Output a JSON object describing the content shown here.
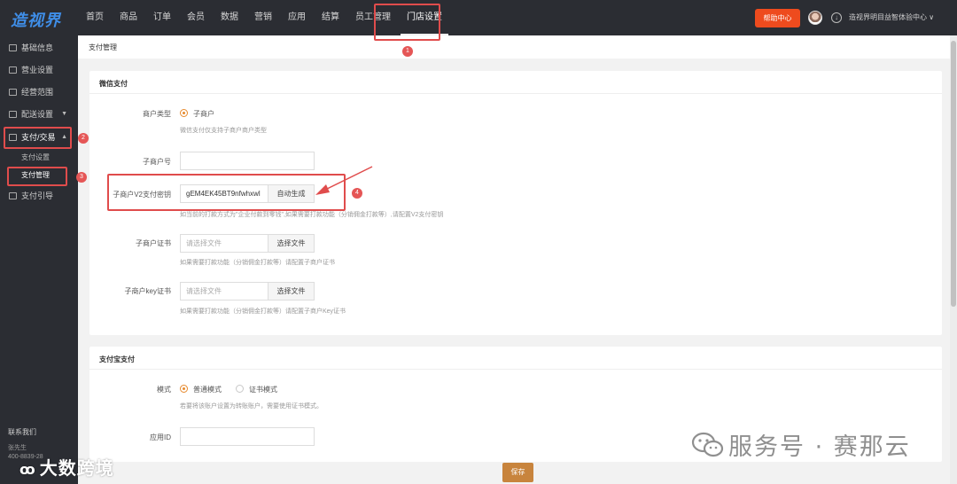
{
  "app": {
    "logo_text": "造视界"
  },
  "topnav": {
    "items": [
      "首页",
      "商品",
      "订单",
      "会员",
      "数据",
      "营销",
      "应用",
      "结算",
      "员工管理",
      "门店设置"
    ],
    "active_index": 9,
    "help_label": "帮助中心",
    "store_name": "造视界明目益智体验中心 ∨"
  },
  "sidebar": {
    "items": [
      "基础信息",
      "营业设置",
      "经营范围",
      "配送设置",
      "支付/交易",
      "支付引导"
    ],
    "sub_items": [
      "支付设置",
      "支付管理"
    ],
    "contact_title": "联系我们",
    "contact_name": "张先生",
    "contact_phone": "400-8839-28"
  },
  "breadcrumb": "支付管理",
  "wechat_pay": {
    "title": "微信支付",
    "merchant_type_label": "商户类型",
    "merchant_type_option": "子商户",
    "merchant_type_hint": "微信支付仅支持子商户商户类型",
    "sub_mch_id_label": "子商户号",
    "sub_mch_id_value": "",
    "v2_key_label": "子商户V2支付密钥",
    "v2_key_value": "gEM4EK45BT9nfwhxwl",
    "auto_generate_label": "自动生成",
    "v2_key_hint": "如当前的打款方式为\"企业付款到零钱\",如果需要打款功能（分销佣金打款等）,请配置V2支付密钥",
    "cert_label": "子商户证书",
    "cert_placeholder": "请选择文件",
    "choose_file_label": "选择文件",
    "cert_hint": "如果需要打款功能（分销佣金打款等）请配置子商户证书",
    "key_cert_label": "子商户key证书",
    "key_cert_placeholder": "请选择文件",
    "key_cert_hint": "如果需要打款功能（分销佣金打款等）请配置子商户Key证书"
  },
  "alipay": {
    "title": "支付宝支付",
    "mode_label": "模式",
    "mode_options": [
      "普通模式",
      "证书模式"
    ],
    "mode_selected": 0,
    "mode_hint": "若要将该账户设置为转账账户，需要使用证书模式。",
    "app_id_label": "应用ID",
    "app_id_value": ""
  },
  "save_label": "保存",
  "annotations": [
    "1",
    "2",
    "3",
    "4"
  ],
  "watermarks": {
    "right": "服务号 · 赛那云",
    "left": "大数跨境"
  },
  "colors": {
    "accent": "#e68a2e",
    "help_button": "#ee4b1e",
    "save_button": "#c8843d",
    "annotation": "#e04c4c",
    "nav_bg": "#2b2d33"
  }
}
